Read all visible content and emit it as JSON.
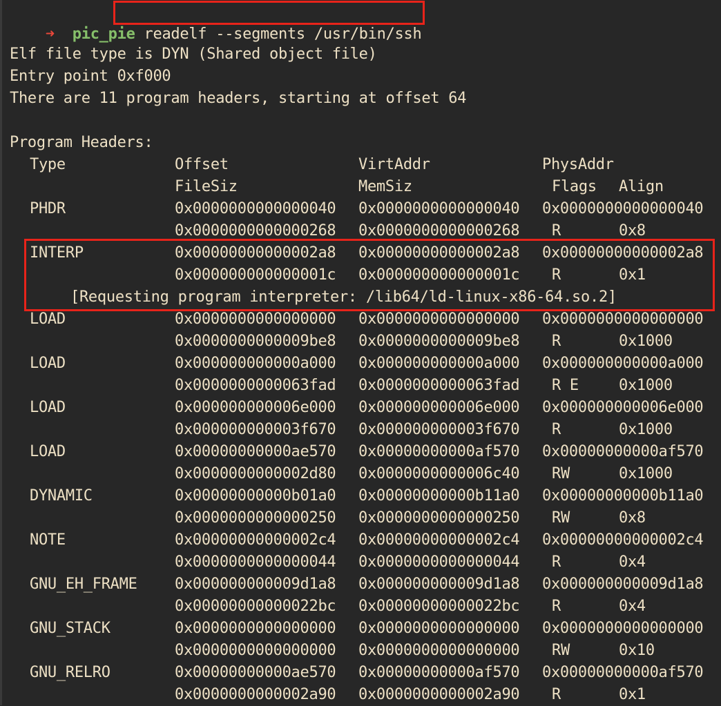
{
  "prompt": {
    "arrow": "➜",
    "directory": "pic_pie",
    "command": "readelf --segments /usr/bin/ssh"
  },
  "output": {
    "file_type": "Elf file type is DYN (Shared object file)",
    "entry_point": "Entry point 0xf000",
    "header_count": "There are 11 program headers, starting at offset 64",
    "section_title": "Program Headers:",
    "columns": {
      "type": "Type",
      "offset": "Offset",
      "virtaddr": "VirtAddr",
      "physaddr": "PhysAddr",
      "filesiz": "FileSiz",
      "memsiz": "MemSiz",
      "flags": "Flags",
      "align": "Align"
    },
    "headers": [
      {
        "type": "PHDR",
        "offset": "0x0000000000000040",
        "virtaddr": "0x0000000000000040",
        "physaddr": "0x0000000000000040",
        "filesiz": "0x0000000000000268",
        "memsiz": "0x0000000000000268",
        "flags": "R",
        "align": "0x8"
      },
      {
        "type": "INTERP",
        "offset": "0x00000000000002a8",
        "virtaddr": "0x00000000000002a8",
        "physaddr": "0x00000000000002a8",
        "filesiz": "0x000000000000001c",
        "memsiz": "0x000000000000001c",
        "flags": "R",
        "align": "0x1",
        "note": "[Requesting program interpreter: /lib64/ld-linux-x86-64.so.2]"
      },
      {
        "type": "LOAD",
        "offset": "0x0000000000000000",
        "virtaddr": "0x0000000000000000",
        "physaddr": "0x0000000000000000",
        "filesiz": "0x0000000000009be8",
        "memsiz": "0x0000000000009be8",
        "flags": "R",
        "align": "0x1000"
      },
      {
        "type": "LOAD",
        "offset": "0x000000000000a000",
        "virtaddr": "0x000000000000a000",
        "physaddr": "0x000000000000a000",
        "filesiz": "0x0000000000063fad",
        "memsiz": "0x0000000000063fad",
        "flags": "R E",
        "align": "0x1000"
      },
      {
        "type": "LOAD",
        "offset": "0x000000000006e000",
        "virtaddr": "0x000000000006e000",
        "physaddr": "0x000000000006e000",
        "filesiz": "0x000000000003f670",
        "memsiz": "0x000000000003f670",
        "flags": "R",
        "align": "0x1000"
      },
      {
        "type": "LOAD",
        "offset": "0x00000000000ae570",
        "virtaddr": "0x00000000000af570",
        "physaddr": "0x00000000000af570",
        "filesiz": "0x0000000000002d80",
        "memsiz": "0x0000000000006c40",
        "flags": "RW",
        "align": "0x1000"
      },
      {
        "type": "DYNAMIC",
        "offset": "0x00000000000b01a0",
        "virtaddr": "0x00000000000b11a0",
        "physaddr": "0x00000000000b11a0",
        "filesiz": "0x0000000000000250",
        "memsiz": "0x0000000000000250",
        "flags": "RW",
        "align": "0x8"
      },
      {
        "type": "NOTE",
        "offset": "0x00000000000002c4",
        "virtaddr": "0x00000000000002c4",
        "physaddr": "0x00000000000002c4",
        "filesiz": "0x0000000000000044",
        "memsiz": "0x0000000000000044",
        "flags": "R",
        "align": "0x4"
      },
      {
        "type": "GNU_EH_FRAME",
        "offset": "0x000000000009d1a8",
        "virtaddr": "0x000000000009d1a8",
        "physaddr": "0x000000000009d1a8",
        "filesiz": "0x00000000000022bc",
        "memsiz": "0x00000000000022bc",
        "flags": "R",
        "align": "0x4"
      },
      {
        "type": "GNU_STACK",
        "offset": "0x0000000000000000",
        "virtaddr": "0x0000000000000000",
        "physaddr": "0x0000000000000000",
        "filesiz": "0x0000000000000000",
        "memsiz": "0x0000000000000000",
        "flags": "RW",
        "align": "0x10"
      },
      {
        "type": "GNU_RELRO",
        "offset": "0x00000000000ae570",
        "virtaddr": "0x00000000000af570",
        "physaddr": "0x00000000000af570",
        "filesiz": "0x0000000000002a90",
        "memsiz": "0x0000000000002a90",
        "flags": "R",
        "align": "0x1"
      }
    ]
  },
  "highlight_color": "#e8231a"
}
